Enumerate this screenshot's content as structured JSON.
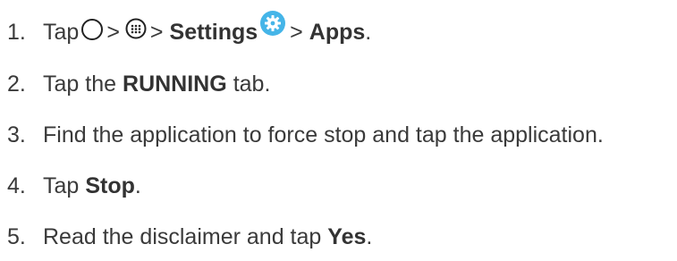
{
  "steps": [
    {
      "number": "1.",
      "tap": "Tap",
      "sep1": ">",
      "sep2": ">",
      "settings": "Settings",
      "sep3": ">",
      "apps": "Apps",
      "end": ".",
      "icons": [
        "home-icon",
        "apps-icon",
        "settings-icon"
      ]
    },
    {
      "number": "2.",
      "prefix": "Tap the",
      "bold": "RUNNING",
      "suffix": "tab."
    },
    {
      "number": "3.",
      "text": "Find the application to force stop and tap the application."
    },
    {
      "number": "4.",
      "prefix": "Tap",
      "bold": "Stop",
      "suffix": "."
    },
    {
      "number": "5.",
      "prefix": "Read the disclaimer and tap",
      "bold": "Yes",
      "suffix": "."
    }
  ],
  "colors": {
    "text": "#3a3a3a",
    "settings_icon": "#45b5e8"
  }
}
